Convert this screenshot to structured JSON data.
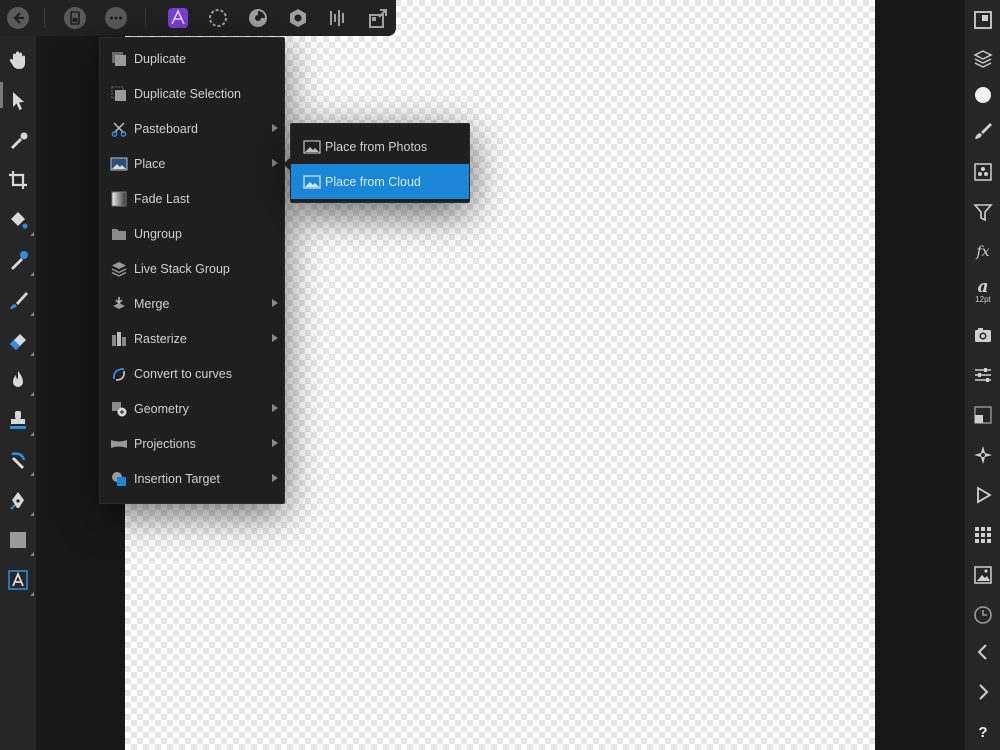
{
  "toolbar": {
    "icons": [
      "back-icon",
      "document-icon",
      "more-icon",
      "photo-persona-icon",
      "liquify-persona-icon",
      "develop-persona-icon",
      "tone-mapping-persona-icon",
      "export-persona-icon",
      "share-icon"
    ]
  },
  "tools": [
    "hand-tool",
    "move-tool",
    "color-picker-tool",
    "crop-tool",
    "flood-fill-tool",
    "selection-brush-tool",
    "paint-brush-tool",
    "erase-brush-tool",
    "burn-tool",
    "clone-tool",
    "inpainting-tool",
    "pen-tool",
    "rectangle-tool",
    "artistic-text-tool"
  ],
  "context_menu": {
    "items": [
      {
        "label": "Duplicate",
        "icon": "duplicate-icon",
        "submenu": false
      },
      {
        "label": "Duplicate Selection",
        "icon": "duplicate-selection-icon",
        "submenu": false
      },
      {
        "label": "Pasteboard",
        "icon": "scissors-icon",
        "submenu": true
      },
      {
        "label": "Place",
        "icon": "place-image-icon",
        "submenu": true
      },
      {
        "label": "Fade Last",
        "icon": "fade-icon",
        "submenu": false
      },
      {
        "label": "Ungroup",
        "icon": "folder-icon",
        "submenu": false
      },
      {
        "label": "Live Stack Group",
        "icon": "stack-icon",
        "submenu": false
      },
      {
        "label": "Merge",
        "icon": "merge-icon",
        "submenu": true
      },
      {
        "label": "Rasterize",
        "icon": "rasterize-icon",
        "submenu": true
      },
      {
        "label": "Convert to curves",
        "icon": "convert-curves-icon",
        "submenu": false
      },
      {
        "label": "Geometry",
        "icon": "geometry-icon",
        "submenu": true
      },
      {
        "label": "Projections",
        "icon": "projections-icon",
        "submenu": true
      },
      {
        "label": "Insertion Target",
        "icon": "insertion-target-icon",
        "submenu": true
      }
    ]
  },
  "submenu": {
    "items": [
      {
        "label": "Place from Photos",
        "icon": "photos-icon",
        "active": false
      },
      {
        "label": "Place from Cloud",
        "icon": "cloud-image-icon",
        "active": true
      }
    ]
  },
  "studio": {
    "font_size_label": "12pt",
    "text_style_glyph": "a",
    "fx_label": "fx",
    "help_label": "?"
  },
  "colors": {
    "accent": "#1a86d8",
    "persona": "#7b3fd4",
    "menu_bg": "#1f1f1f",
    "toolbar_bg": "#262626"
  }
}
